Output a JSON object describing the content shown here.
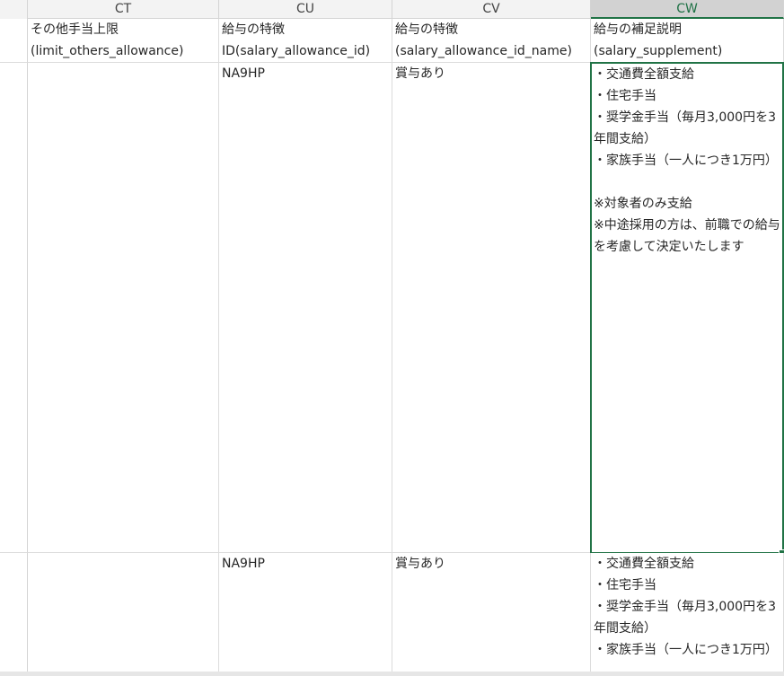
{
  "columns": [
    {
      "id": "CT",
      "label": "CT"
    },
    {
      "id": "CU",
      "label": "CU"
    },
    {
      "id": "CV",
      "label": "CV"
    },
    {
      "id": "CW",
      "label": "CW"
    }
  ],
  "header_row": {
    "CT": "その他手当上限\n(limit_others_allowance)",
    "CU": "給与の特徴\nID(salary_allowance_id)",
    "CV": "給与の特徴\n(salary_allowance_id_name)",
    "CW": "給与の補足説明\n(salary_supplement)"
  },
  "rows": [
    {
      "CT": "",
      "CU": "NA9HP",
      "CV": "賞与あり",
      "CW": "・交通費全額支給\n・住宅手当\n・奨学金手当（毎月3,000円を3年間支給）\n・家族手当（一人につき1万円）\n\n※対象者のみ支給\n※中途採用の方は、前職での給与を考慮して決定いたします"
    },
    {
      "CT": "",
      "CU": "NA9HP",
      "CV": "賞与あり",
      "CW": "・交通費全額支給\n・住宅手当\n・奨学金手当（毎月3,000円を3年間支給）\n・家族手当（一人につき1万円）"
    }
  ],
  "selection": {
    "column": "CW",
    "row": 1
  },
  "colors": {
    "accent": "#217346",
    "header_bg": "#f3f3f3",
    "selected_header_bg": "#d2d2d2",
    "gridline": "#dcdcdc"
  }
}
